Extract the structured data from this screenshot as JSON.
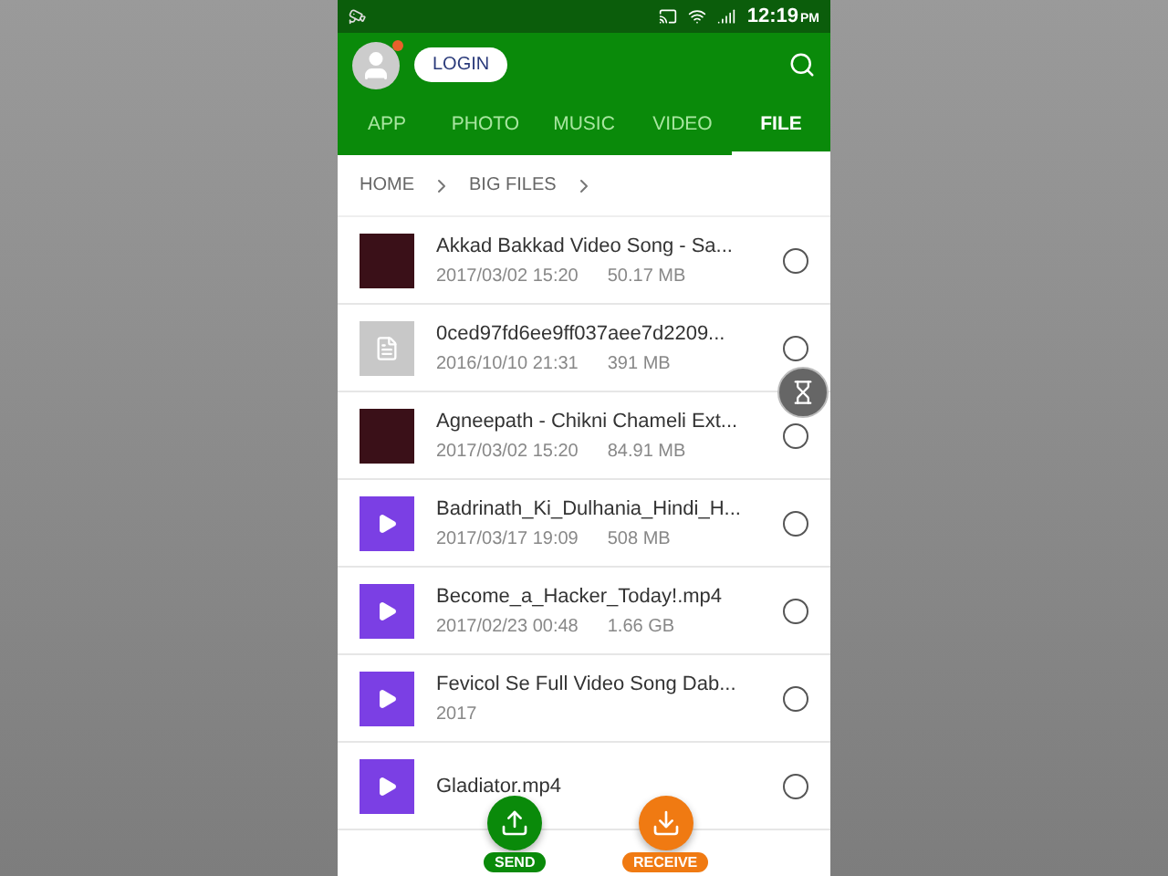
{
  "status_bar": {
    "time": "12:19",
    "ampm": "PM"
  },
  "toolbar": {
    "login": "LOGIN",
    "notification": true
  },
  "tabs": [
    {
      "label": "APP",
      "selected": false
    },
    {
      "label": "PHOTO",
      "selected": false
    },
    {
      "label": "MUSIC",
      "selected": false
    },
    {
      "label": "VIDEO",
      "selected": false
    },
    {
      "label": "FILE",
      "selected": true
    }
  ],
  "breadcrumb": [
    "HOME",
    "BIG FILES"
  ],
  "files": [
    {
      "kind": "photo",
      "name": "Akkad Bakkad Video Song - Sa...",
      "date": "2017/03/02 15:20",
      "size": "50.17 MB",
      "selected": false
    },
    {
      "kind": "document",
      "name": "0ced97fd6ee9ff037aee7d2209...",
      "date": "2016/10/10 21:31",
      "size": "391 MB",
      "selected": false
    },
    {
      "kind": "photo",
      "name": "Agneepath - Chikni Chameli Ext...",
      "date": "2017/03/02 15:20",
      "size": "84.91 MB",
      "selected": false
    },
    {
      "kind": "video",
      "name": "Badrinath_Ki_Dulhania_Hindi_H...",
      "date": "2017/03/17 19:09",
      "size": "508 MB",
      "selected": false
    },
    {
      "kind": "video",
      "name": "Become_a_Hacker_Today!.mp4",
      "date": "2017/02/23 00:48",
      "size": "1.66 GB",
      "selected": false
    },
    {
      "kind": "video",
      "name": "Fevicol Se Full Video Song Dab...",
      "date": "2017",
      "selected": false
    },
    {
      "kind": "video",
      "name": "Gladiator.mp4",
      "selected": false
    }
  ],
  "actions": [
    {
      "kind": "send",
      "label": "SEND"
    },
    {
      "kind": "receive",
      "label": "RECEIVE"
    }
  ]
}
